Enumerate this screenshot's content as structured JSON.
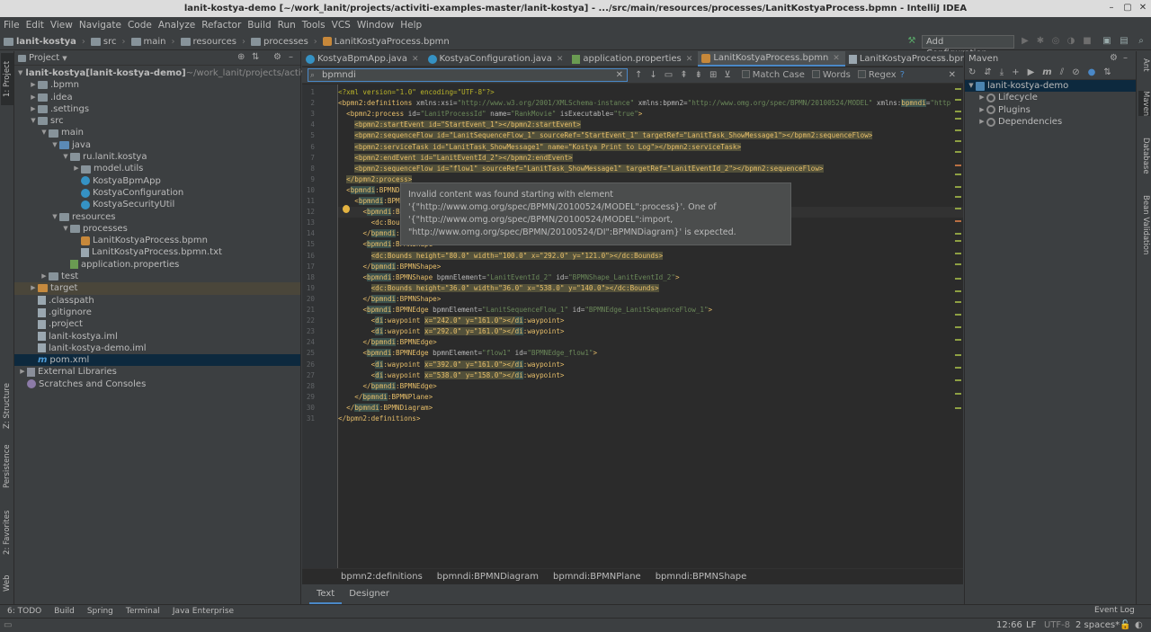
{
  "window": {
    "title": "lanit-kostya-demo [~/work_lanit/projects/activiti-examples-master/lanit-kostya] - .../src/main/resources/processes/LanitKostyaProcess.bpmn - IntelliJ IDEA"
  },
  "menu": [
    "File",
    "Edit",
    "View",
    "Navigate",
    "Code",
    "Analyze",
    "Refactor",
    "Build",
    "Run",
    "Tools",
    "VCS",
    "Window",
    "Help"
  ],
  "breadcrumb": [
    "lanit-kostya",
    "src",
    "main",
    "resources",
    "processes",
    "LanitKostyaProcess.bpmn"
  ],
  "toolbar": {
    "add_config": "Add Configuration..."
  },
  "project": {
    "title": "Project",
    "tree": [
      {
        "label": "lanit-kostya",
        "extra": " [lanit-kostya-demo]",
        "path": " ~/work_lanit/projects/activiti",
        "depth": 0,
        "arrow": "down",
        "icon": "folder"
      },
      {
        "label": ".bpmn",
        "depth": 1,
        "arrow": "right",
        "icon": "folder"
      },
      {
        "label": ".idea",
        "depth": 1,
        "arrow": "right",
        "icon": "folder"
      },
      {
        "label": ".settings",
        "depth": 1,
        "arrow": "right",
        "icon": "folder"
      },
      {
        "label": "src",
        "depth": 1,
        "arrow": "down",
        "icon": "folder"
      },
      {
        "label": "main",
        "depth": 2,
        "arrow": "down",
        "icon": "folder"
      },
      {
        "label": "java",
        "depth": 3,
        "arrow": "down",
        "icon": "folder-blue"
      },
      {
        "label": "ru.lanit.kostya",
        "depth": 4,
        "arrow": "down",
        "icon": "folder"
      },
      {
        "label": "model.utils",
        "depth": 5,
        "arrow": "right",
        "icon": "folder"
      },
      {
        "label": "KostyaBpmApp",
        "depth": 5,
        "arrow": "",
        "icon": "class"
      },
      {
        "label": "KostyaConfiguration",
        "depth": 5,
        "arrow": "",
        "icon": "class"
      },
      {
        "label": "KostyaSecurityUtil",
        "depth": 5,
        "arrow": "",
        "icon": "class"
      },
      {
        "label": "resources",
        "depth": 3,
        "arrow": "down",
        "icon": "folder"
      },
      {
        "label": "processes",
        "depth": 4,
        "arrow": "down",
        "icon": "folder"
      },
      {
        "label": "LanitKostyaProcess.bpmn",
        "depth": 5,
        "arrow": "",
        "icon": "bpmn"
      },
      {
        "label": "LanitKostyaProcess.bpmn.txt",
        "depth": 5,
        "arrow": "",
        "icon": "file"
      },
      {
        "label": "application.properties",
        "depth": 4,
        "arrow": "",
        "icon": "props"
      },
      {
        "label": "test",
        "depth": 2,
        "arrow": "right",
        "icon": "folder"
      },
      {
        "label": "target",
        "depth": 1,
        "arrow": "right",
        "icon": "folder-o",
        "hl": true
      },
      {
        "label": ".classpath",
        "depth": 1,
        "arrow": "",
        "icon": "file"
      },
      {
        "label": ".gitignore",
        "depth": 1,
        "arrow": "",
        "icon": "file"
      },
      {
        "label": ".project",
        "depth": 1,
        "arrow": "",
        "icon": "file"
      },
      {
        "label": "lanit-kostya.iml",
        "depth": 1,
        "arrow": "",
        "icon": "file"
      },
      {
        "label": "lanit-kostya-demo.iml",
        "depth": 1,
        "arrow": "",
        "icon": "file"
      },
      {
        "label": "pom.xml",
        "depth": 1,
        "arrow": "",
        "icon": "maven",
        "sel": true
      },
      {
        "label": "External Libraries",
        "depth": 0,
        "arrow": "right",
        "icon": "lib"
      },
      {
        "label": "Scratches and Consoles",
        "depth": 0,
        "arrow": "",
        "icon": "scratch"
      }
    ]
  },
  "tabs": [
    {
      "label": "KostyaBpmApp.java",
      "icon": "class"
    },
    {
      "label": "KostyaConfiguration.java",
      "icon": "class"
    },
    {
      "label": "application.properties",
      "icon": "props"
    },
    {
      "label": "LanitKostyaProcess.bpmn",
      "icon": "bpmn",
      "active": true
    },
    {
      "label": "LanitKostyaProcess.bpmn.txt",
      "icon": "file"
    }
  ],
  "find": {
    "query": "bpmndi",
    "match_case": "Match Case",
    "words": "Words",
    "regex": "Regex",
    "help": "?"
  },
  "tooltip": [
    "Invalid content was found starting with element",
    "'{\"http://www.omg.org/spec/BPMN/20100524/MODEL\":process}'. One of",
    "'{\"http://www.omg.org/spec/BPMN/20100524/MODEL\":import,",
    "\"http://www.omg.org/spec/BPMN/20100524/DI\":BPMNDiagram}' is expected."
  ],
  "code_crumbs": [
    "bpmn2:definitions",
    "bpmndi:BPMNDiagram",
    "bpmndi:BPMNPlane",
    "bpmndi:BPMNShape"
  ],
  "editor_tabs": [
    "Text",
    "Designer"
  ],
  "maven": {
    "title": "Maven",
    "tree": [
      {
        "label": "lanit-kostya-demo",
        "depth": 0,
        "arrow": "down",
        "sel": true
      },
      {
        "label": "Lifecycle",
        "depth": 1,
        "arrow": "right"
      },
      {
        "label": "Plugins",
        "depth": 1,
        "arrow": "right"
      },
      {
        "label": "Dependencies",
        "depth": 1,
        "arrow": "right"
      }
    ]
  },
  "left_tabs": [
    "1: Project",
    "Z: Structure",
    "Persistence",
    "2: Favorites",
    "Web"
  ],
  "right_tabs": [
    "Ant",
    "Maven",
    "Database",
    "Bean Validation"
  ],
  "bottom_tools": [
    "6: TODO",
    "Build",
    "Spring",
    "Terminal",
    "Java Enterprise"
  ],
  "status": {
    "position": "12:66",
    "line_sep": "LF",
    "encoding": "UTF-8",
    "indent": "2 spaces*",
    "event_log": "Event Log"
  }
}
